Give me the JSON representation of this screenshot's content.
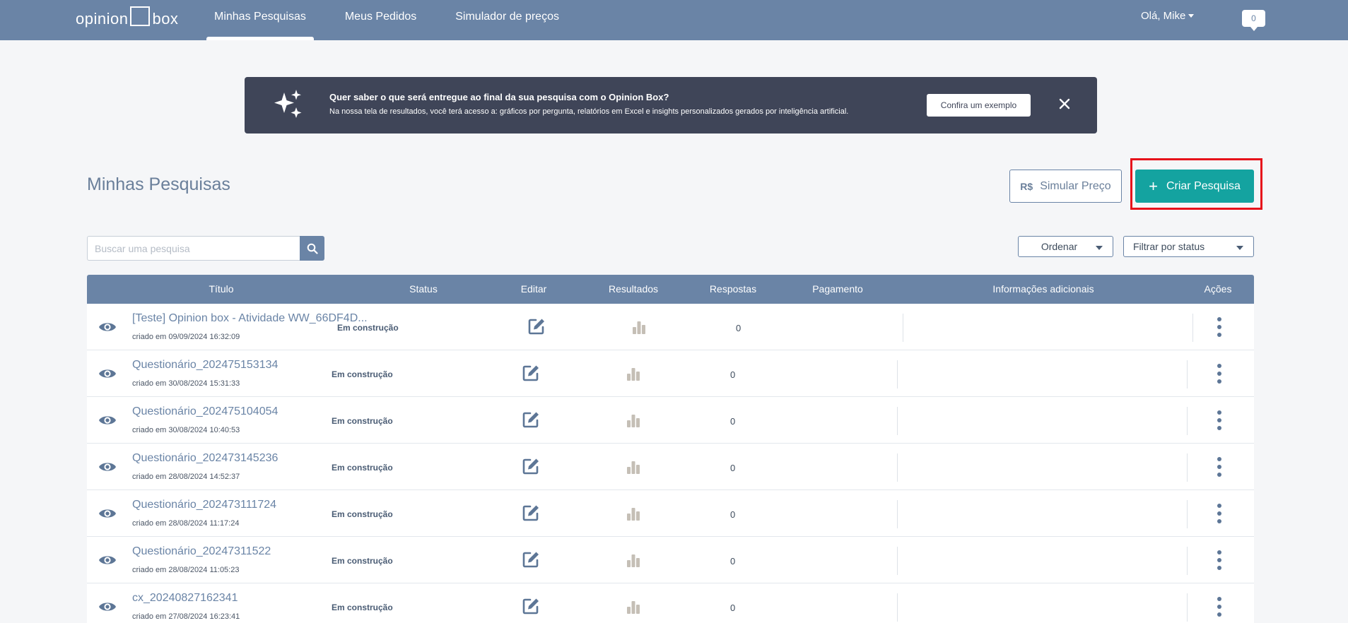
{
  "logo": {
    "left": "opinion",
    "right": "box"
  },
  "nav": {
    "items": [
      {
        "label": "Minhas Pesquisas",
        "active": true
      },
      {
        "label": "Meus Pedidos",
        "active": false
      },
      {
        "label": "Simulador de preços",
        "active": false
      }
    ]
  },
  "user": {
    "greeting": "Olá, Mike",
    "notifications": "0"
  },
  "banner": {
    "title": "Quer saber o que será entregue ao final da sua pesquisa com o Opinion Box?",
    "text": "Na nossa tela de resultados, você terá acesso a: gráficos por pergunta, relatórios em Excel e insights personalizados gerados por inteligência artificial.",
    "button": "Confira um exemplo"
  },
  "page": {
    "title": "Minhas Pesquisas"
  },
  "actions": {
    "simulate_prefix": "R$",
    "simulate_label": "Simular Preço",
    "create_label": "Criar Pesquisa"
  },
  "search": {
    "placeholder": "Buscar uma pesquisa"
  },
  "filters": {
    "order_label": "Ordenar",
    "status_label": "Filtrar por status"
  },
  "table": {
    "headers": {
      "title": "Título",
      "status": "Status",
      "edit": "Editar",
      "results": "Resultados",
      "responses": "Respostas",
      "payment": "Pagamento",
      "info": "Informações adicionais",
      "actions": "Ações"
    },
    "rows": [
      {
        "title": "[Teste] Opinion box - Atividade WW_66DF4D...",
        "created": "criado em 09/09/2024 16:32:09",
        "status": "Em construção",
        "responses": "0"
      },
      {
        "title": "Questionário_202475153134",
        "created": "criado em 30/08/2024 15:31:33",
        "status": "Em construção",
        "responses": "0"
      },
      {
        "title": "Questionário_202475104054",
        "created": "criado em 30/08/2024 10:40:53",
        "status": "Em construção",
        "responses": "0"
      },
      {
        "title": "Questionário_202473145236",
        "created": "criado em 28/08/2024 14:52:37",
        "status": "Em construção",
        "responses": "0"
      },
      {
        "title": "Questionário_202473111724",
        "created": "criado em 28/08/2024 11:17:24",
        "status": "Em construção",
        "responses": "0"
      },
      {
        "title": "Questionário_20247311522",
        "created": "criado em 28/08/2024 11:05:23",
        "status": "Em construção",
        "responses": "0"
      },
      {
        "title": "cx_20240827162341",
        "created": "criado em 27/08/2024 16:23:41",
        "status": "Em construção",
        "responses": "0"
      }
    ]
  },
  "colors": {
    "header": "#6a84a6",
    "primary": "#14a3a0",
    "banner": "#3f4558",
    "highlight": "#e6131b"
  }
}
